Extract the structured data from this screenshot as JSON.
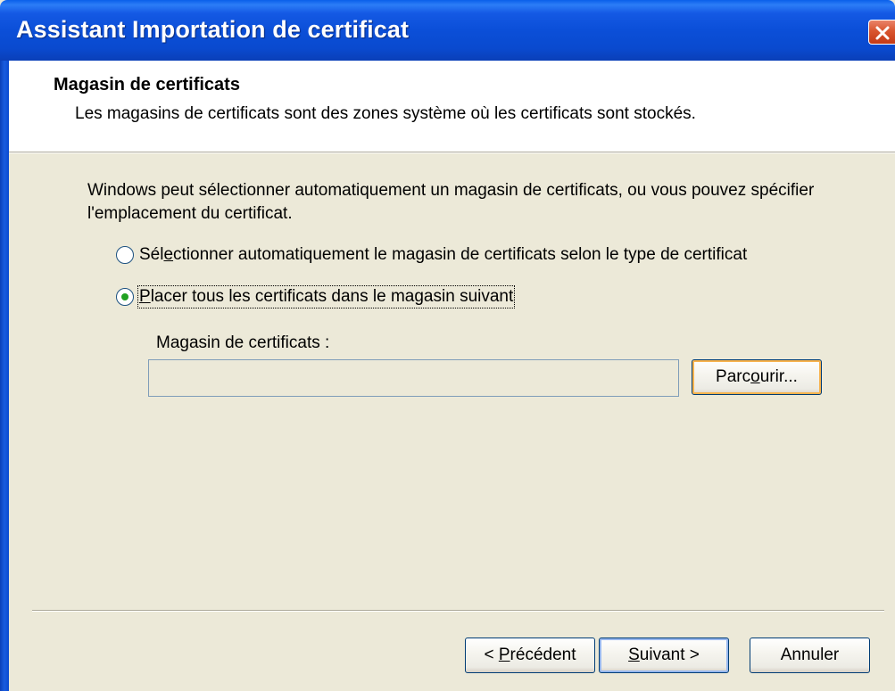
{
  "window": {
    "title": "Assistant Importation de certificat"
  },
  "header": {
    "title": "Magasin de certificats",
    "subtitle": "Les magasins de certificats sont des zones système où les certificats sont stockés."
  },
  "body": {
    "intro": "Windows peut sélectionner automatiquement un magasin de certificats, ou vous pouvez spécifier l'emplacement du certificat.",
    "options": [
      {
        "pre": "Sél",
        "accel": "e",
        "post": "ctionner automatiquement le magasin de certificats selon le type de certificat",
        "selected": false
      },
      {
        "pre": "",
        "accel": "P",
        "post": "lacer tous les certificats dans le magasin suivant",
        "selected": true
      }
    ],
    "store_label": "Magasin de certificats :",
    "store_value": "",
    "browse": {
      "pre": "Parc",
      "accel": "o",
      "post": "urir..."
    }
  },
  "footer": {
    "back": {
      "pre": "< ",
      "accel": "P",
      "post": "récédent"
    },
    "next": {
      "pre": "",
      "accel": "S",
      "post": "uivant >"
    },
    "cancel": {
      "label": "Annuler"
    }
  },
  "colors": {
    "titlebar": "#0A4ACF",
    "dialog_bg": "#ECE9D8",
    "radio_dot": "#21A121",
    "close_btn": "#D9552F"
  }
}
